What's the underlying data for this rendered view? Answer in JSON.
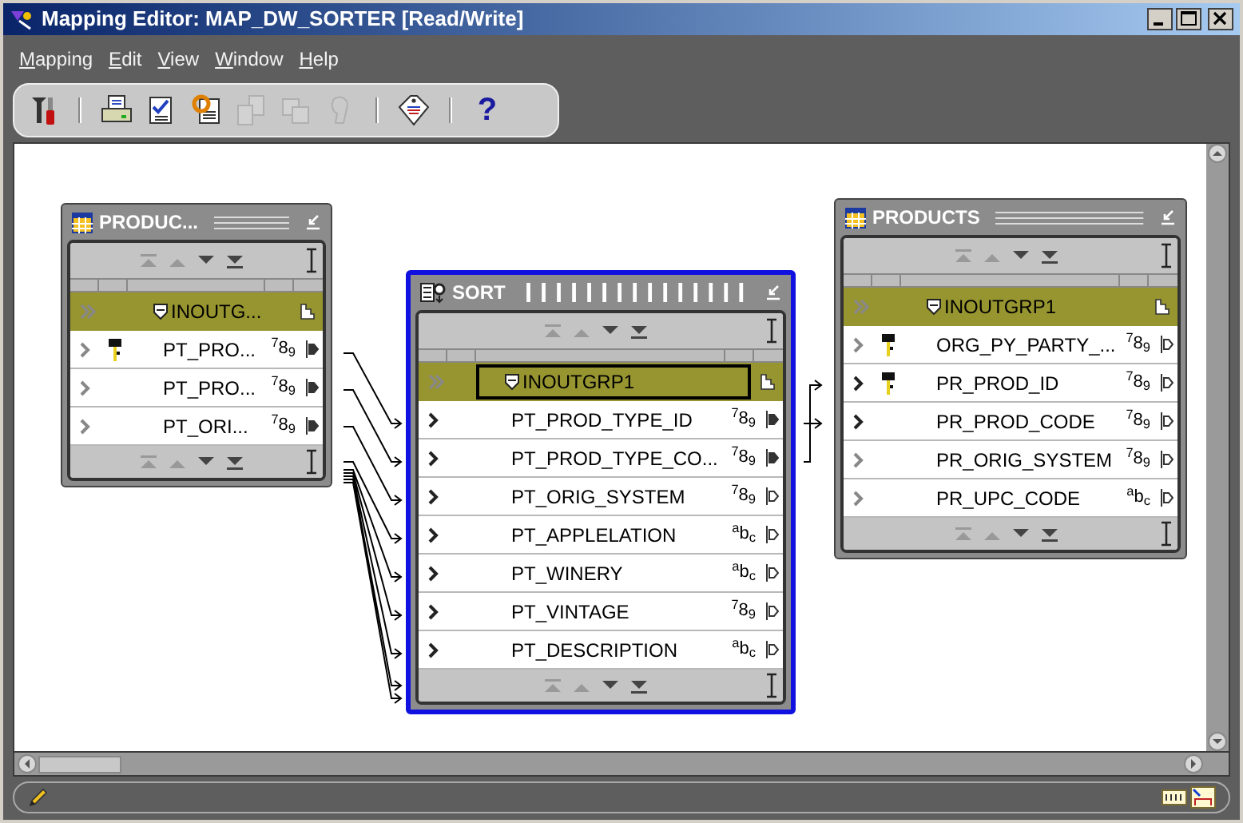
{
  "window": {
    "title": "Mapping Editor: MAP_DW_SORTER [Read/Write]"
  },
  "menu": [
    "Mapping",
    "Edit",
    "View",
    "Window",
    "Help"
  ],
  "toolbar": [
    {
      "kind": "tools",
      "disabled": false
    },
    {
      "kind": "separator"
    },
    {
      "kind": "print",
      "disabled": false
    },
    {
      "kind": "validate",
      "disabled": false
    },
    {
      "kind": "generate",
      "disabled": false
    },
    {
      "kind": "deploy",
      "disabled": true
    },
    {
      "kind": "copy",
      "disabled": true
    },
    {
      "kind": "hand",
      "disabled": true
    },
    {
      "kind": "separator"
    },
    {
      "kind": "tag",
      "disabled": false
    },
    {
      "kind": "separator"
    },
    {
      "kind": "help",
      "label": "?",
      "disabled": false
    }
  ],
  "operators": [
    {
      "kind": "table",
      "title": "PRODUC...",
      "selected": false,
      "group": {
        "name": "INOUTG...",
        "selected": false
      },
      "attributes": [
        {
          "name": "PT_PRO...",
          "key": true,
          "type_label": "$^{7}$8$_{9}$",
          "in_mapped": false,
          "out_mapped": true
        },
        {
          "name": "PT_PRO...",
          "key": false,
          "type_label": "$^{7}$8$_{9}$",
          "in_mapped": false,
          "out_mapped": true
        },
        {
          "name": "PT_ORI...",
          "key": false,
          "type_label": "$^{7}$8$_{9}$",
          "in_mapped": false,
          "out_mapped": true
        }
      ]
    },
    {
      "kind": "sort",
      "title": "SORT",
      "selected": true,
      "group": {
        "name": "INOUTGRP1",
        "selected": true
      },
      "attributes": [
        {
          "name": "PT_PROD_TYPE_ID",
          "key": false,
          "type_label": "$^{7}$8$_{9}$",
          "in_mapped": true,
          "out_mapped": true
        },
        {
          "name": "PT_PROD_TYPE_CO...",
          "key": false,
          "type_label": "$^{7}$8$_{9}$",
          "in_mapped": true,
          "out_mapped": true
        },
        {
          "name": "PT_ORIG_SYSTEM",
          "key": false,
          "type_label": "$^{7}$8$_{9}$",
          "in_mapped": true,
          "out_mapped": false
        },
        {
          "name": "PT_APPLELATION",
          "key": false,
          "type_label": "$^{a}$b$_{c}$",
          "in_mapped": true,
          "out_mapped": false
        },
        {
          "name": "PT_WINERY",
          "key": false,
          "type_label": "$^{a}$b$_{c}$",
          "in_mapped": true,
          "out_mapped": false
        },
        {
          "name": "PT_VINTAGE",
          "key": false,
          "type_label": "$^{7}$8$_{9}$",
          "in_mapped": true,
          "out_mapped": false
        },
        {
          "name": "PT_DESCRIPTION",
          "key": false,
          "type_label": "$^{a}$b$_{c}$",
          "in_mapped": true,
          "out_mapped": false
        }
      ]
    },
    {
      "kind": "table",
      "title": "PRODUCTS",
      "selected": false,
      "group": {
        "name": "INOUTGRP1",
        "selected": false
      },
      "attributes": [
        {
          "name": "ORG_PY_PARTY_...",
          "key": true,
          "type_label": "$^{7}$8$_{9}$",
          "in_mapped": false,
          "out_mapped": false
        },
        {
          "name": "PR_PROD_ID",
          "key": true,
          "type_label": "$^{7}$8$_{9}$",
          "in_mapped": true,
          "out_mapped": false
        },
        {
          "name": "PR_PROD_CODE",
          "key": false,
          "type_label": "$^{7}$8$_{9}$",
          "in_mapped": true,
          "out_mapped": false
        },
        {
          "name": "PR_ORIG_SYSTEM",
          "key": false,
          "type_label": "$^{7}$8$_{9}$",
          "in_mapped": false,
          "out_mapped": false
        },
        {
          "name": "PR_UPC_CODE",
          "key": false,
          "type_label": "$^{a}$b$_{c}$",
          "in_mapped": false,
          "out_mapped": false
        }
      ]
    }
  ]
}
